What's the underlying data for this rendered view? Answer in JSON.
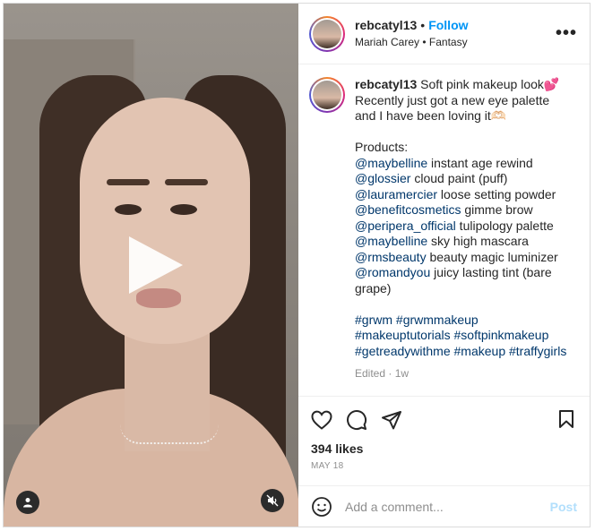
{
  "post": {
    "username": "rebcatyl13",
    "follow_label": "Follow",
    "music": "Mariah Carey • Fantasy",
    "more_label": "•••"
  },
  "caption": {
    "username": "rebcatyl13",
    "line1": " Soft pink makeup look💕",
    "line2": "Recently just got a new eye palette and I have been loving it🫶🏻",
    "products_label": "Products:",
    "products": [
      {
        "mention": "@maybelline",
        "text": " instant age rewind"
      },
      {
        "mention": "@glossier",
        "text": " cloud paint (puff)"
      },
      {
        "mention": "@lauramercier",
        "text": " loose setting powder"
      },
      {
        "mention": "@benefitcosmetics",
        "text": " gimme brow"
      },
      {
        "mention": "@peripera_official",
        "text": " tulipology palette"
      },
      {
        "mention": "@maybelline",
        "text": " sky high mascara"
      },
      {
        "mention": "@rmsbeauty",
        "text": " beauty magic luminizer"
      },
      {
        "mention": "@romandyou",
        "text": " juicy lasting tint (bare grape)"
      }
    ],
    "hashtags": [
      "#grwm",
      "#grwmmakeup",
      "#makeuptutorials",
      "#softpinkmakeup",
      "#getreadywithme",
      "#makeup",
      "#traffygirls"
    ],
    "edited": "Edited · 1w"
  },
  "stats": {
    "likes": "394 likes",
    "date": "MAY 18"
  },
  "comment": {
    "placeholder": "Add a comment...",
    "post_label": "Post"
  },
  "icons": {
    "like": "heart-icon",
    "comment": "comment-icon",
    "share": "share-icon",
    "save": "bookmark-icon",
    "emoji": "emoji-icon",
    "play": "play-icon",
    "tags": "user-tag-icon",
    "mute": "muted-icon"
  },
  "colors": {
    "follow": "#0095f6",
    "mention": "#00376b",
    "post_disabled": "#b2dffc"
  }
}
